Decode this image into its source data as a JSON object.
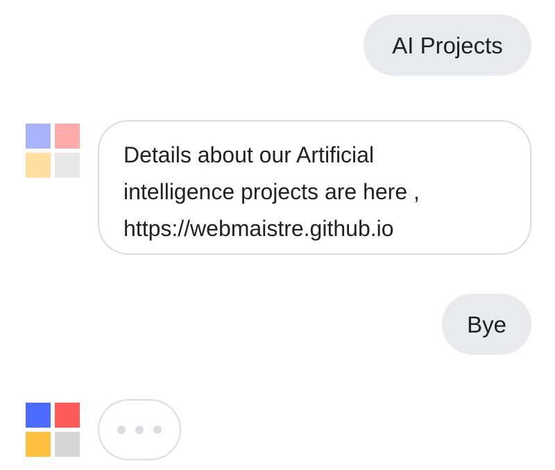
{
  "messages": [
    {
      "role": "user",
      "text": "AI Projects"
    },
    {
      "role": "assistant",
      "lines": [
        "Details about our Artificial",
        "intelligence projects are here ,",
        "https://webmaistre.github.io"
      ]
    },
    {
      "role": "user",
      "text": "Bye"
    },
    {
      "role": "assistant",
      "typing": true
    }
  ],
  "avatar": {
    "icon": "assistant-logo-icon",
    "colors_faded": [
      "#aab3ff",
      "#ffaaab",
      "#ffdea0",
      "#e8e8e8"
    ],
    "colors_active": [
      "#4d6aff",
      "#ff5a5a",
      "#ffbf40",
      "#d6d6d6"
    ]
  },
  "colors": {
    "user_bubble": "#e8eaed",
    "bot_bubble_border": "#dadce0",
    "text": "#202124",
    "typing_dot": "#dadce0"
  }
}
